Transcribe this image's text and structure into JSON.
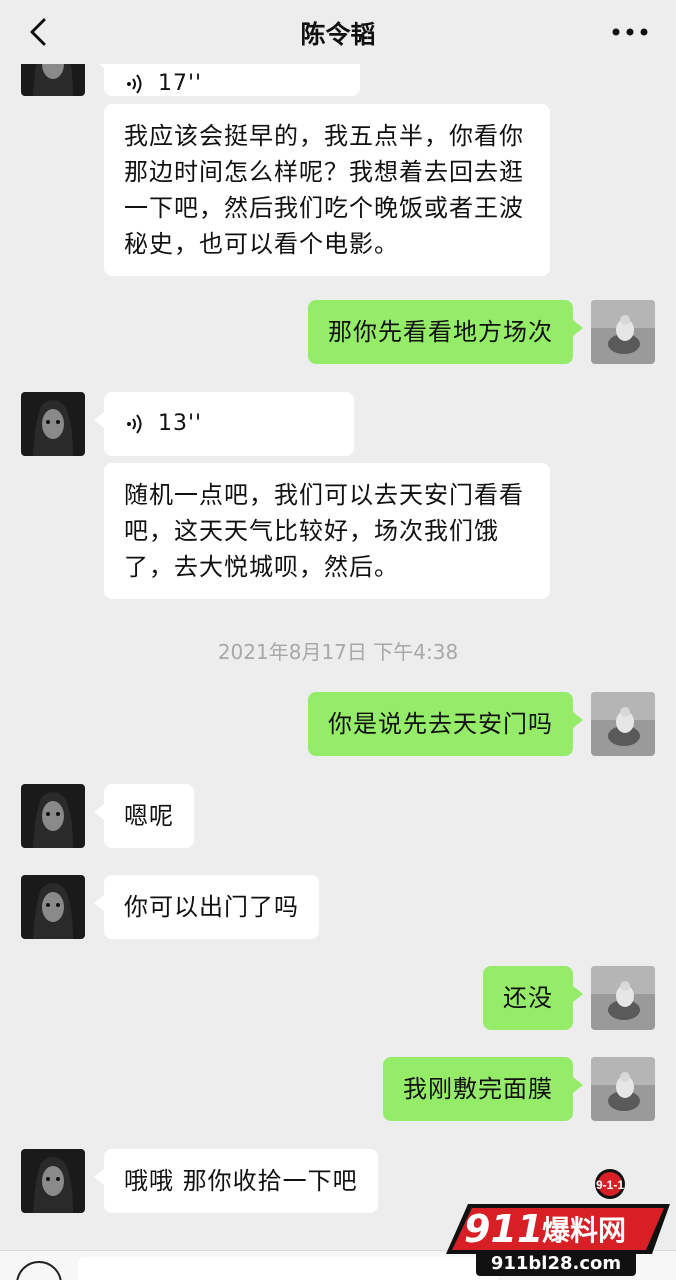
{
  "header": {
    "title": "陈令韬"
  },
  "messages": [
    {
      "side": "them",
      "voice_duration": "17''"
    },
    {
      "side": "them",
      "text": "我应该会挺早的，我五点半，你看你那边时间怎么样呢？我想着去回去逛一下吧，然后我们吃个晚饭或者王波秘史，也可以看个电影。"
    },
    {
      "side": "me",
      "text": "那你先看看地方场次"
    },
    {
      "side": "them",
      "voice_duration": "13''"
    },
    {
      "side": "them",
      "text": "随机一点吧，我们可以去天安门看看吧，这天天气比较好，场次我们饿了，去大悦城呗，然后。"
    },
    {
      "side": "me",
      "text": "你是说先去天安门吗"
    },
    {
      "side": "them",
      "text": "嗯呢"
    },
    {
      "side": "them",
      "text": "你可以出门了吗"
    },
    {
      "side": "me",
      "text": "还没"
    },
    {
      "side": "me",
      "text": "我刚敷完面膜"
    },
    {
      "side": "them",
      "text": "哦哦 那你收拾一下吧"
    }
  ],
  "timestamp": "2021年8月17日 下午4:38",
  "watermark": {
    "badge": "9-1-1",
    "brand_num": "911",
    "brand_cn": "爆料网",
    "url": "911bl28.com"
  },
  "colors": {
    "background": "#ededed",
    "me_bubble": "#95ec69",
    "them_bubble": "#ffffff",
    "watermark_red": "#d81f26"
  }
}
